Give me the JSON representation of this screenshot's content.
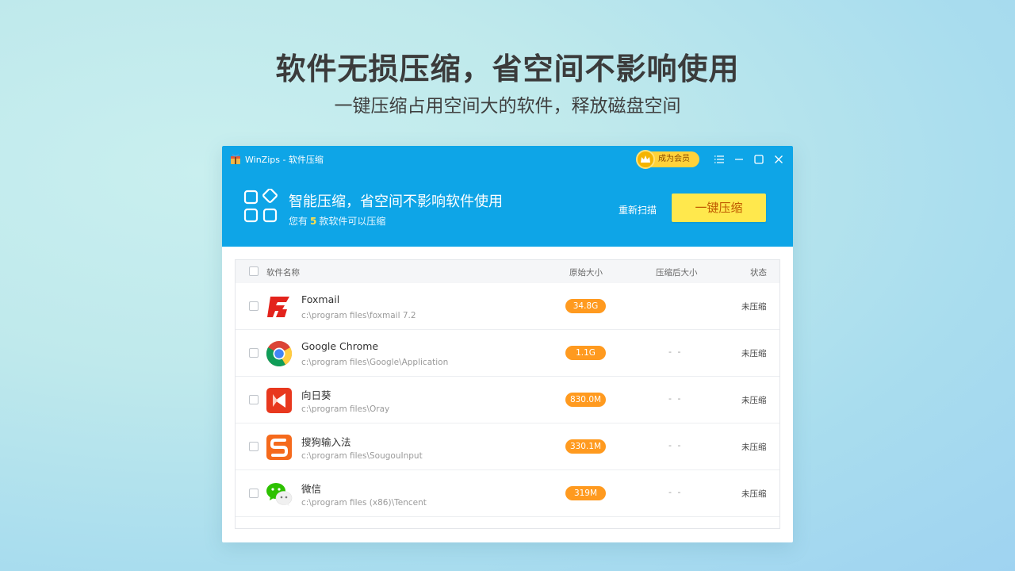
{
  "hero": {
    "title": "软件无损压缩，省空间不影响使用",
    "subtitle": "一键压缩占用空间大的软件，释放磁盘空间"
  },
  "window": {
    "title": "WinZips - 软件压缩",
    "vip_label": "成为会员",
    "controls": [
      "menu-icon",
      "minimize-icon",
      "maximize-icon",
      "close-icon"
    ]
  },
  "header": {
    "title": "智能压缩，省空间不影响软件使用",
    "sub_prefix": "您有",
    "count": "5",
    "sub_suffix": "款软件可以压缩",
    "rescan_label": "重新扫描",
    "compress_label": "一键压缩"
  },
  "table": {
    "columns": {
      "name": "软件名称",
      "original_size": "原始大小",
      "compressed_size": "压缩后大小",
      "status": "状态"
    },
    "rows": [
      {
        "name": "Foxmail",
        "path": "c:\\program files\\foxmail 7.2",
        "size": "34.8G",
        "after": "",
        "status": "未压缩",
        "icon": "foxmail-icon"
      },
      {
        "name": "Google Chrome",
        "path": "c:\\program files\\Google\\Application",
        "size": "1.1G",
        "after": "- -",
        "status": "未压缩",
        "icon": "chrome-icon"
      },
      {
        "name": "向日葵",
        "path": "c:\\program files\\Oray",
        "size": "830.0M",
        "after": "- -",
        "status": "未压缩",
        "icon": "sunlogin-icon"
      },
      {
        "name": "搜狗输入法",
        "path": "c:\\program files\\SougouInput",
        "size": "330.1M",
        "after": "- -",
        "status": "未压缩",
        "icon": "sogou-icon"
      },
      {
        "name": "微信",
        "path": "c:\\program files (x86)\\Tencent",
        "size": "319M",
        "after": "- -",
        "status": "未压缩",
        "icon": "wechat-icon"
      }
    ]
  },
  "colors": {
    "accent": "#0ea5e7",
    "button": "#ffe84d",
    "size_badge": "#ff9a1f"
  }
}
